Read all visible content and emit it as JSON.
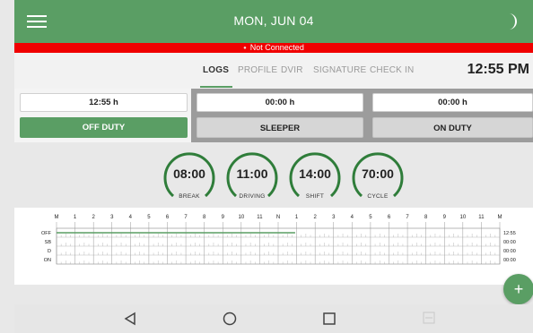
{
  "header": {
    "date": "MON, JUN 04",
    "menu_icon": "menu-icon",
    "theme_icon": "moon-icon"
  },
  "status": {
    "text": "Not Connected",
    "color": "#f00000"
  },
  "tabs": [
    {
      "label": "LOGS",
      "active": true
    },
    {
      "label": "PROFILE",
      "active": false
    },
    {
      "label": "DVIR",
      "active": false
    },
    {
      "label": "SIGNATURE",
      "active": false
    },
    {
      "label": "CHECK IN",
      "active": false
    }
  ],
  "clock": "12:55 PM",
  "duty": {
    "off_duty": {
      "value": "12:55 h",
      "label": "OFF DUTY",
      "active": true
    },
    "sleeper": {
      "value": "00:00 h",
      "label": "SLEEPER",
      "active": false
    },
    "on_duty": {
      "value": "00:00 h",
      "label": "ON DUTY",
      "active": false
    }
  },
  "gauges": [
    {
      "value": "08:00",
      "label": "BREAK"
    },
    {
      "value": "11:00",
      "label": "DRIVING"
    },
    {
      "value": "14:00",
      "label": "SHIFT"
    },
    {
      "value": "70:00",
      "label": "CYCLE"
    }
  ],
  "log_graph": {
    "hour_labels": [
      "M",
      "1",
      "2",
      "3",
      "4",
      "5",
      "6",
      "7",
      "8",
      "9",
      "10",
      "11",
      "N",
      "1",
      "2",
      "3",
      "4",
      "5",
      "6",
      "7",
      "8",
      "9",
      "10",
      "11",
      "M"
    ],
    "rows": [
      {
        "label": "OFF",
        "total": "12:55"
      },
      {
        "label": "SB",
        "total": "00:00"
      },
      {
        "label": "D",
        "total": "00:00"
      },
      {
        "label": "ON",
        "total": "00:00"
      }
    ],
    "off_duty_until_hour": 12.92,
    "line_color": "#5a9e64"
  },
  "fab": {
    "label": "+"
  },
  "navbar": {
    "icons": [
      "back-icon",
      "home-icon",
      "recents-icon",
      "keyboard-icon"
    ]
  },
  "colors": {
    "primary": "#5a9e64",
    "danger": "#f00000"
  }
}
